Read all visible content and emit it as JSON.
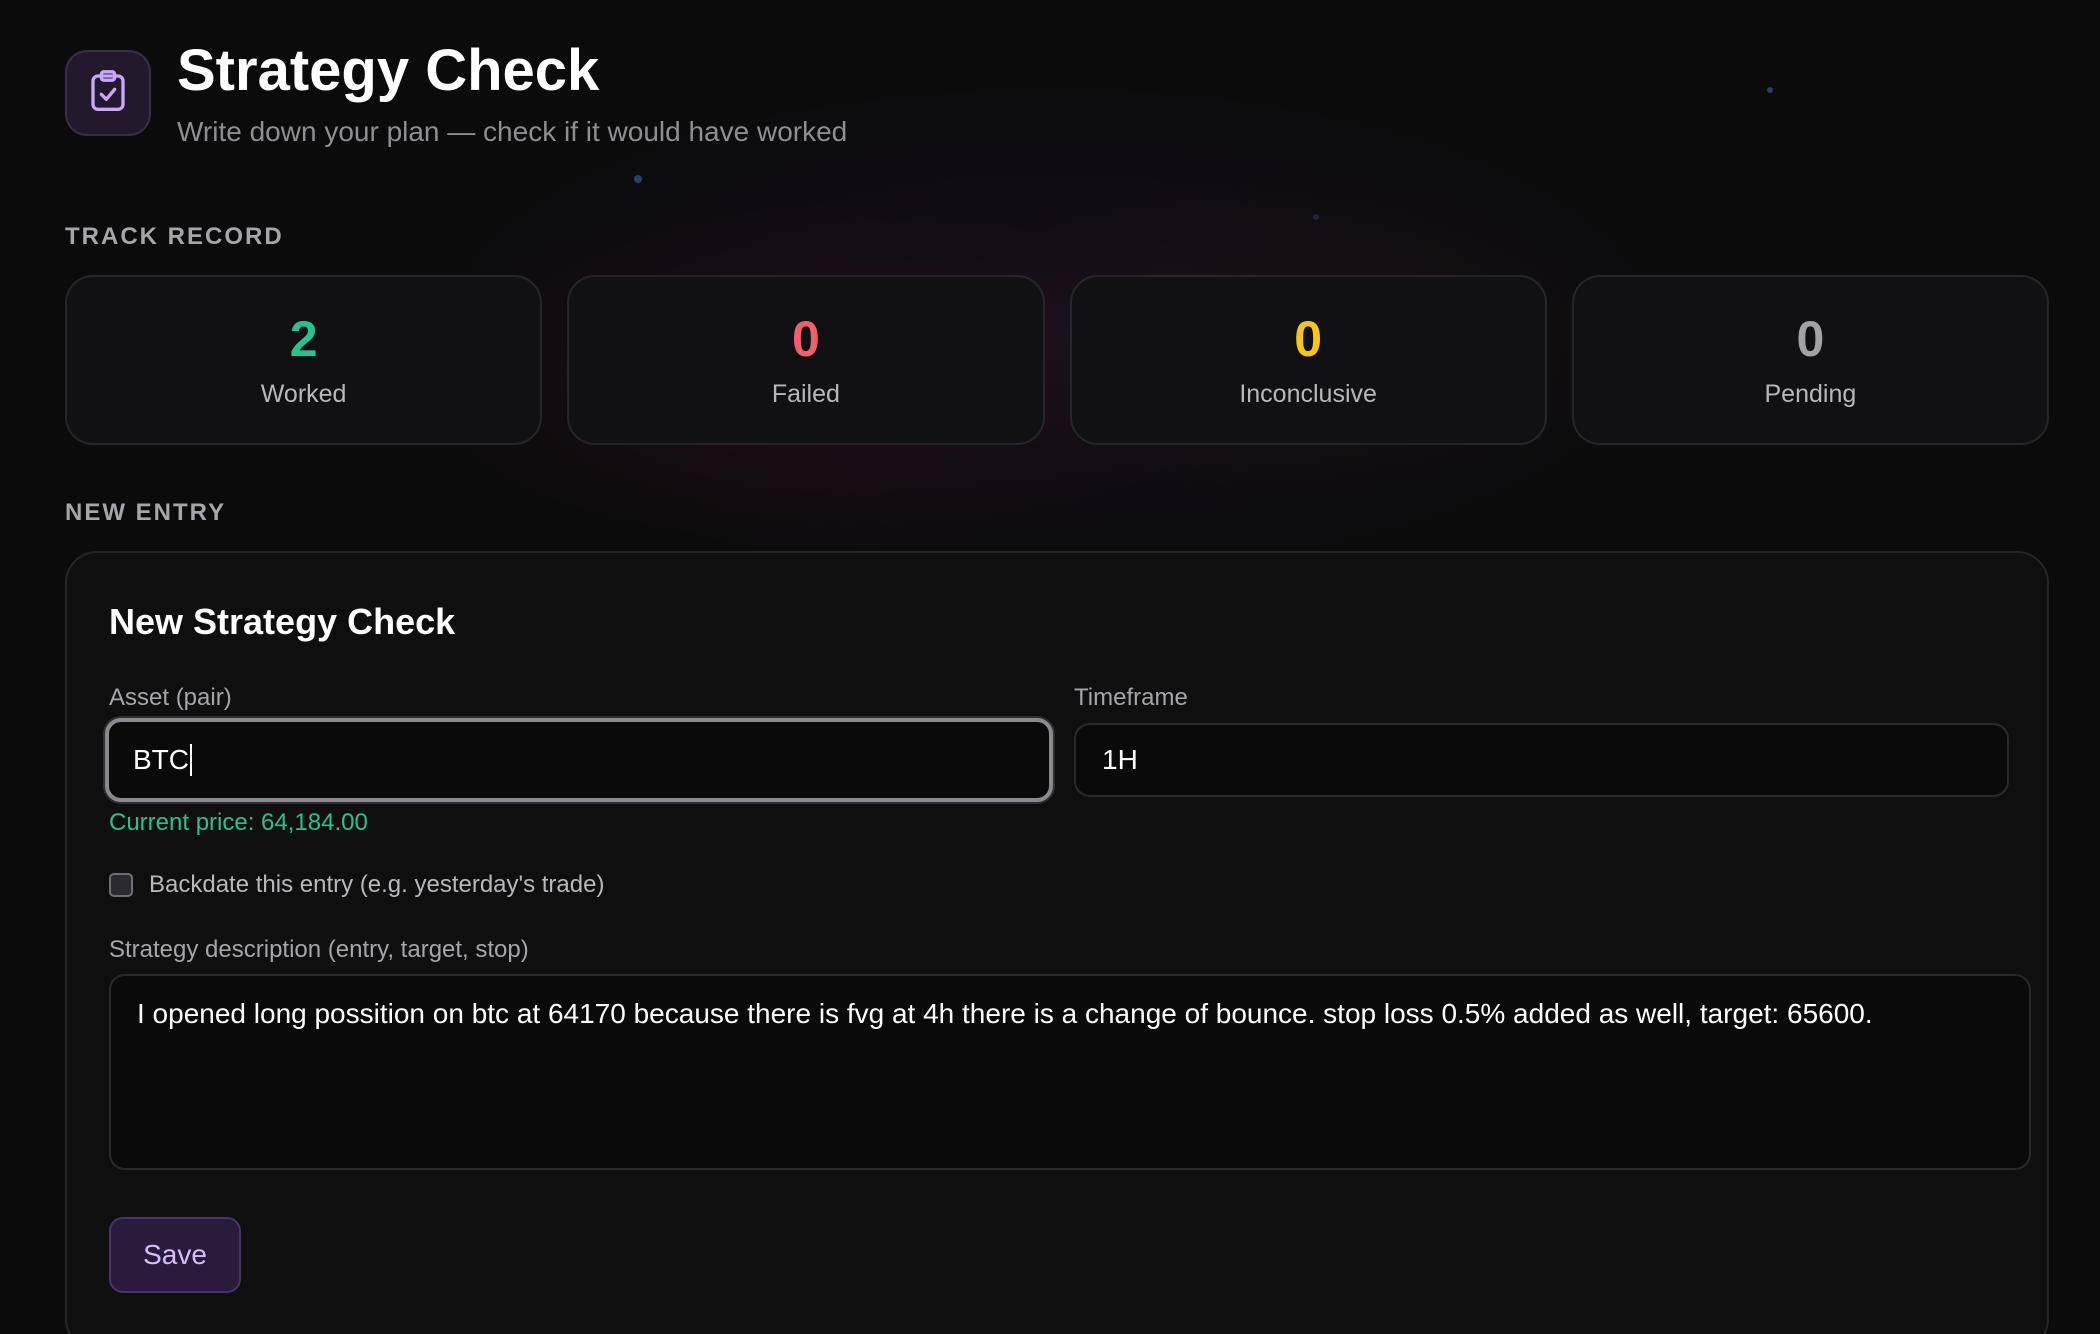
{
  "header": {
    "title": "Strategy Check",
    "subtitle": "Write down your plan — check if it would have worked",
    "icon": "clipboard-check-icon"
  },
  "track_record": {
    "section_label": "TRACK RECORD",
    "stats": [
      {
        "value": "2",
        "label": "Worked",
        "color": "#22c58b"
      },
      {
        "value": "0",
        "label": "Failed",
        "color": "#f0606b"
      },
      {
        "value": "0",
        "label": "Inconclusive",
        "color": "#f5c518"
      },
      {
        "value": "0",
        "label": "Pending",
        "color": "#a1a1a6"
      }
    ]
  },
  "new_entry": {
    "section_label": "NEW ENTRY",
    "form_title": "New Strategy Check",
    "asset": {
      "label": "Asset (pair)",
      "value": "BTC"
    },
    "timeframe": {
      "label": "Timeframe",
      "value": "1H"
    },
    "current_price": "Current price: 64,184.00",
    "backdate": {
      "label": "Backdate this entry (e.g. yesterday's trade)",
      "checked": false
    },
    "description": {
      "label": "Strategy description (entry, target, stop)",
      "value": "I opened long possition on btc at 64170 because there is fvg at 4h there is a change of bounce. stop loss 0.5% added as well, target: 65600."
    },
    "save_label": "Save"
  },
  "colors": {
    "accent": "#d8bcff",
    "success": "#22c58b",
    "danger": "#f0606b",
    "warning": "#f5c518",
    "neutral": "#a1a1a6"
  }
}
